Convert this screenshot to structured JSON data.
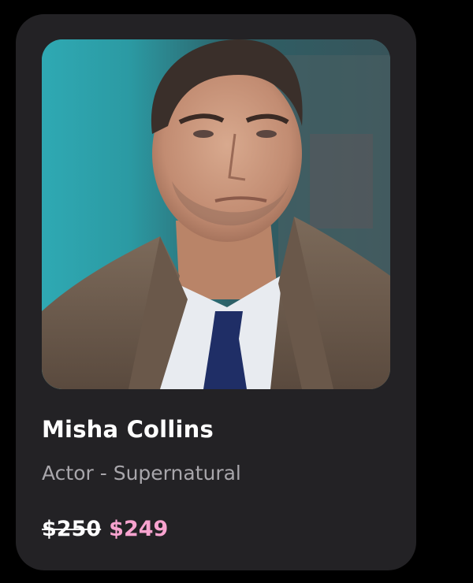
{
  "card": {
    "name": "Misha Collins",
    "subtitle": "Actor - Supernatural",
    "old_price": "$250",
    "new_price": "$249"
  },
  "colors": {
    "card_background": "#232225",
    "name": "#ffffff",
    "subtitle": "#a8a6ab",
    "new_price": "#f8a3cf"
  },
  "icons": {
    "photo": "actor-portrait-photo"
  }
}
